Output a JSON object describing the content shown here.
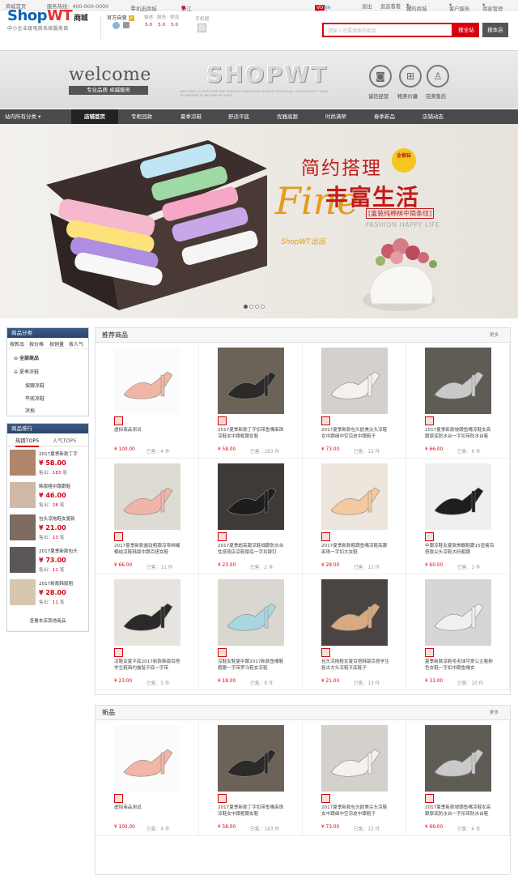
{
  "topbar": {
    "home": "商城首页",
    "hotline": "服务热线：400-000-0000",
    "mobile": "手机逛商城",
    "location": "浙江",
    "greeting": "您好，",
    "user": "admin",
    "vip": "V0",
    "logout": "退出",
    "nav_links": [
      "逛逛看看",
      "我的商城",
      "客户服务",
      "商家管理"
    ]
  },
  "header": {
    "logo_main": "ShopWT",
    "logo_suffix": "商城",
    "logo_sub": "中小企业级电商系统服务商",
    "store_title": "官方自营",
    "ratings": [
      {
        "label": "描述",
        "value": "5.0"
      },
      {
        "label": "服务",
        "value": "5.0"
      },
      {
        "label": "物流",
        "value": "5.0"
      }
    ],
    "mobile_label": "手机版",
    "search_placeholder": "请输入您要搜索的商品",
    "search_all": "搜全站",
    "search_store": "搜本店"
  },
  "store_band": {
    "welcome": "welcome",
    "slogan": "专业品质  卓越服务",
    "brand": "SHOPWT",
    "fine_print": "WELCOME TO OUR SHOP THE SHOP ALL GOODS ARE QUALITY GOODS ALL GOODS SHOP 7 DAYS NO REASON TO RETURN MY SHOP",
    "badges": [
      {
        "icon": "camera-icon",
        "label": "诚信经营"
      },
      {
        "icon": "gift-icon",
        "label": "物美价廉"
      },
      {
        "icon": "user-icon",
        "label": "完美售后"
      }
    ]
  },
  "nav": {
    "items": [
      "站内所有分类",
      "店铺首页",
      "专柜回款",
      "夏季凉鞋",
      "舒适平底",
      "优雅高跟",
      "时尚满帮",
      "春季新品",
      "店铺动态"
    ]
  },
  "banner": {
    "line1": "简约搭理",
    "badge": "全棉袜",
    "fine": "Fine",
    "line2": "丰富生活",
    "line3": "[盒装纯棉袜中简条纹]",
    "line4": "FASHION HAPPY LIFE",
    "line5": "ShopWT出品",
    "active_slide": 1,
    "slide_count": 4
  },
  "sidebar": {
    "category_title": "商品分类",
    "category_tabs": [
      "按新品",
      "按价格",
      "按销量",
      "按人气"
    ],
    "categories": [
      "全部商品",
      "夏季凉鞋",
      "坡跟凉鞋",
      "平底凉鞋",
      "凉拖"
    ],
    "rank_title": "商品排行",
    "rank_tabs": [
      "热销TOP5",
      "人气TOP5"
    ],
    "sold_label": "售出：",
    "unit": "笔",
    "rank_items": [
      {
        "name": "2017夏季新款丁字",
        "price": "¥ 58.00",
        "sold": "183"
      },
      {
        "name": "韩版粗中跟跟鞋",
        "price": "¥ 46.00",
        "sold": "28"
      },
      {
        "name": "包头凉拖鞋女夏新",
        "price": "¥ 21.00",
        "sold": "13"
      },
      {
        "name": "2017夏季新款包头",
        "price": "¥ 73.00",
        "sold": "12"
      },
      {
        "name": "2017新款韩版粗",
        "price": "¥ 28.00",
        "sold": "11"
      }
    ],
    "view_more": "查看本店其他商品"
  },
  "recommend": {
    "title": "推荐商品",
    "more": "更多",
    "sold_prefix": "已售：",
    "unit": "件",
    "products": [
      {
        "name": "虚拟商品测试",
        "price": "¥ 100.00",
        "sold": "4"
      },
      {
        "name": "2017夏季新款丁字扣带鱼嘴串珠凉鞋女中跟粗跟女鞋",
        "price": "¥ 58.00",
        "sold": "183"
      },
      {
        "name": "2017夏季新款包头欧美尖头凉鞋女中跟细中空凉皮中跟鞋子",
        "price": "¥ 73.00",
        "sold": "12"
      },
      {
        "name": "2017夏季新款坡跟鱼嘴凉鞋女高跟厚底防水台一字扣带防水台鞋",
        "price": "¥ 66.00",
        "sold": "6"
      },
      {
        "name": "2017夏季新款露趾粗跟凉带绑蝴蝶结凉鞋韩版中跟百搭女鞋",
        "price": "¥ 66.00",
        "sold": "11"
      },
      {
        "name": "2017夏季超高跟凉鞋细跟防水台性感夜店凉鞋厚底一字扣铆钉",
        "price": "¥ 23.00",
        "sold": "2"
      },
      {
        "name": "2017夏季新款粗跟鱼嘴凉鞋高跟串珠一字扣大女鞋",
        "price": "¥ 28.00",
        "sold": "11"
      },
      {
        "name": "中跟凉鞋女夏款美観鞋跟15显瘦百搭款尖头凉鞋大码粗跟",
        "price": "¥ 60.00",
        "sold": "3"
      },
      {
        "name": "凉鞋女夏平底2017新款韩版百搭学生鞋简约露趾平底一字带",
        "price": "¥ 23.00",
        "sold": "5"
      },
      {
        "name": "凉鞋女鞋夏中跟2017新款鱼嘴鞋粗跟一字带罗马鞋女凉鞋",
        "price": "¥ 18.00",
        "sold": "8"
      },
      {
        "name": "包头凉拖鞋女夏百搭韩版百搭学生复古方头凉鞋平底鞋子",
        "price": "¥ 21.00",
        "sold": "13"
      },
      {
        "name": "夏季新款凉鞋毛毛球可爱公主鞋粉色女鞋一字扣中跟鱼嘴女",
        "price": "¥ 33.00",
        "sold": "10"
      }
    ]
  },
  "new_arrivals": {
    "title": "新品",
    "more": "更多",
    "products": [
      {
        "name": "虚拟商品测试",
        "price": "¥ 100.00",
        "sold": "4"
      },
      {
        "name": "2017夏季新款丁字扣带鱼嘴串珠凉鞋女中跟粗跟女鞋",
        "price": "¥ 58.00",
        "sold": "183"
      },
      {
        "name": "2017夏季新款包头欧美尖头凉鞋女中跟细中空凉皮中跟鞋子",
        "price": "¥ 73.00",
        "sold": "12"
      },
      {
        "name": "2017夏季新款坡跟鱼嘴凉鞋女高跟厚底防水台一字扣带防水台鞋",
        "price": "¥ 66.00",
        "sold": "6"
      }
    ]
  },
  "colors": {
    "accent": "#d6000f",
    "nav": "#4a4a4a",
    "sidebar_header": "#34527b",
    "logo_blue": "#0b62b5"
  }
}
